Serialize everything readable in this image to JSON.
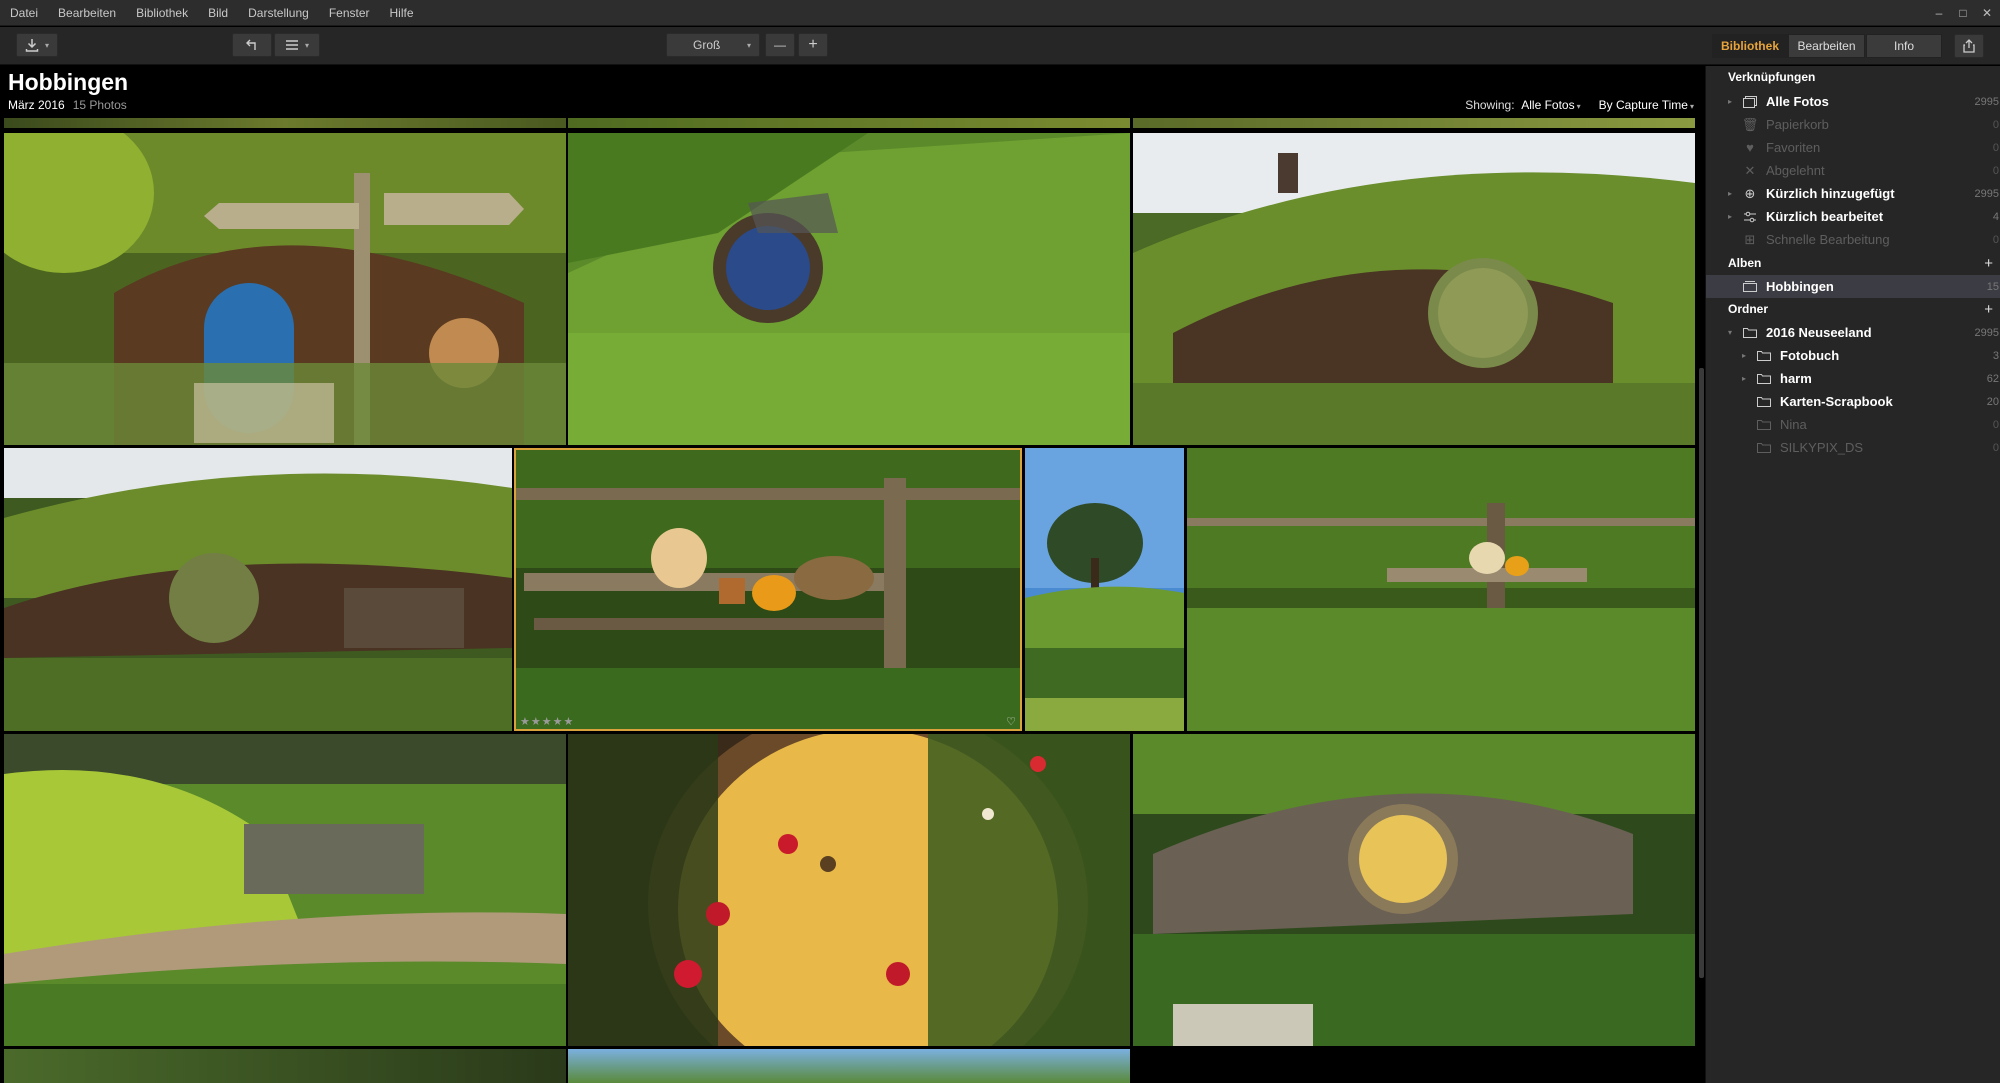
{
  "menu": [
    "Datei",
    "Bearbeiten",
    "Bibliothek",
    "Bild",
    "Darstellung",
    "Fenster",
    "Hilfe"
  ],
  "window_controls": [
    "–",
    "□",
    "✕"
  ],
  "toolbar": {
    "size_label": "Groß",
    "zoom_out": "—",
    "zoom_in": "+",
    "tabs": [
      "Bibliothek",
      "Bearbeiten",
      "Info"
    ],
    "active_tab": "Bibliothek"
  },
  "album": {
    "title": "Hobbingen",
    "date": "März 2016",
    "count": "15 Photos"
  },
  "showing": {
    "label": "Showing:",
    "value": "Alle Fotos",
    "sort": "By Capture Time"
  },
  "photos": [
    {
      "name": "signpost-blue-door",
      "desc": "Hobbit hole with blue door and West Farthing signpost"
    },
    {
      "name": "round-window-grass",
      "desc": "Round window in grassy hill"
    },
    {
      "name": "hobbit-hole-green-door",
      "desc": "Hobbit hole with round green door"
    },
    {
      "name": "hobbit-hole-garden",
      "desc": "Hobbit hole with garden"
    },
    {
      "name": "pumpkins-bench",
      "desc": "Pumpkins on wooden bench",
      "selected": true,
      "rating": "★★★★★"
    },
    {
      "name": "lone-tree",
      "desc": "Tree on hill"
    },
    {
      "name": "bench-fence-garden",
      "desc": "Bench with vegetables near fence"
    },
    {
      "name": "grassy-hill-path",
      "desc": "Grassy slope with path"
    },
    {
      "name": "yellow-door-flowers",
      "desc": "Yellow door with red flowers"
    },
    {
      "name": "bag-end-yellow-door",
      "desc": "Hobbit hole with yellow round door"
    },
    {
      "name": "bottom-left-partial",
      "desc": "Partial photo"
    },
    {
      "name": "bottom-mid-partial",
      "desc": "Partial photo sky"
    }
  ],
  "sidebar": {
    "shortcuts_label": "Verknüpfungen",
    "shortcuts": [
      {
        "label": "Alle Fotos",
        "count": "2995",
        "icon": "photos-icon",
        "dim": false,
        "arrow": true
      },
      {
        "label": "Papierkorb",
        "count": "0",
        "icon": "trash-icon",
        "dim": true,
        "arrow": false
      },
      {
        "label": "Favoriten",
        "count": "0",
        "icon": "heart-icon",
        "dim": true,
        "arrow": false
      },
      {
        "label": "Abgelehnt",
        "count": "0",
        "icon": "x-icon",
        "dim": true,
        "arrow": false
      },
      {
        "label": "Kürzlich hinzugefügt",
        "count": "2995",
        "icon": "plus-circle-icon",
        "dim": false,
        "arrow": true
      },
      {
        "label": "Kürzlich bearbeitet",
        "count": "4",
        "icon": "sliders-icon",
        "dim": false,
        "arrow": true
      },
      {
        "label": "Schnelle Bearbeitung",
        "count": "0",
        "icon": "grid-icon",
        "dim": true,
        "arrow": false
      }
    ],
    "albums_label": "Alben",
    "albums": [
      {
        "label": "Hobbingen",
        "count": "15",
        "active": true
      }
    ],
    "folders_label": "Ordner",
    "folders": [
      {
        "label": "2016 Neuseeland",
        "count": "2995",
        "level": 0,
        "dim": false,
        "arrow": "▾"
      },
      {
        "label": "Fotobuch",
        "count": "3",
        "level": 1,
        "dim": false,
        "arrow": "▸"
      },
      {
        "label": "harm",
        "count": "62",
        "level": 1,
        "dim": false,
        "arrow": "▸"
      },
      {
        "label": "Karten-Scrapbook",
        "count": "20",
        "level": 1,
        "dim": false,
        "arrow": ""
      },
      {
        "label": "Nina",
        "count": "0",
        "level": 1,
        "dim": true,
        "arrow": ""
      },
      {
        "label": "SILKYPIX_DS",
        "count": "0",
        "level": 1,
        "dim": true,
        "arrow": ""
      }
    ]
  }
}
